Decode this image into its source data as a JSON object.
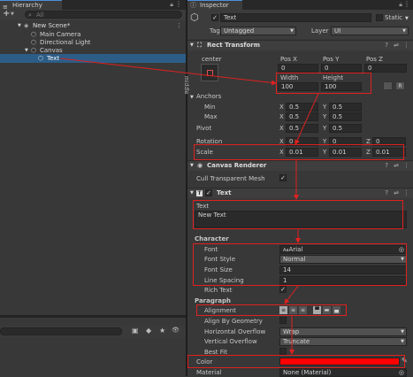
{
  "hierarchy": {
    "tab": "Hierarchy",
    "add_label": "+",
    "search_placeholder": "All",
    "items": [
      {
        "label": "New Scene*"
      },
      {
        "label": "Main Camera"
      },
      {
        "label": "Directional Light"
      },
      {
        "label": "Canvas"
      },
      {
        "label": "Text"
      }
    ]
  },
  "inspector": {
    "tab": "Inspector",
    "object_name": "Text",
    "static_label": "Static",
    "tag_label": "Tag",
    "tag_value": "Untagged",
    "layer_label": "Layer",
    "layer_value": "UI",
    "rect_transform": {
      "title": "Rect Transform",
      "anchor_h": "center",
      "anchor_v": "middle",
      "posx_label": "Pos X",
      "posy_label": "Pos Y",
      "posz_label": "Pos Z",
      "posx": "0",
      "posy": "0",
      "posz": "0",
      "width_label": "Width",
      "height_label": "Height",
      "width": "100",
      "height": "100",
      "blueprint_btn": "",
      "raw_btn": "R",
      "anchors_label": "Anchors",
      "min_label": "Min",
      "max_label": "Max",
      "min_x": "0.5",
      "min_y": "0.5",
      "max_x": "0.5",
      "max_y": "0.5",
      "pivot_label": "Pivot",
      "pivot_x": "0.5",
      "pivot_y": "0.5",
      "rotation_label": "Rotation",
      "rot_x": "0",
      "rot_y": "0",
      "rot_z": "0",
      "scale_label": "Scale",
      "scale_x": "0.01",
      "scale_y": "0.01",
      "scale_z": "0.01",
      "x": "X",
      "y": "Y",
      "z": "Z"
    },
    "canvas_renderer": {
      "title": "Canvas Renderer",
      "cull_label": "Cull Transparent Mesh"
    },
    "text": {
      "title": "Text",
      "text_label": "Text",
      "text_value": "New Text",
      "character_label": "Character",
      "font_label": "Font",
      "font_value": "Arial",
      "font_prefix": "Aa",
      "font_style_label": "Font Style",
      "font_style_value": "Normal",
      "font_size_label": "Font Size",
      "font_size_value": "14",
      "line_spacing_label": "Line Spacing",
      "line_spacing_value": "1",
      "rich_text_label": "Rich Text",
      "paragraph_label": "Paragraph",
      "alignment_label": "Alignment",
      "align_geo_label": "Align By Geometry",
      "h_overflow_label": "Horizontal Overflow",
      "h_overflow_value": "Wrap",
      "v_overflow_label": "Vertical Overflow",
      "v_overflow_value": "Truncate",
      "best_fit_label": "Best Fit",
      "color_label": "Color",
      "color_value": "#ff0000",
      "material_label": "Material",
      "material_value": "None (Material)"
    }
  },
  "colors": {
    "accent": "#2c5d87",
    "annotation": "#e02020"
  }
}
